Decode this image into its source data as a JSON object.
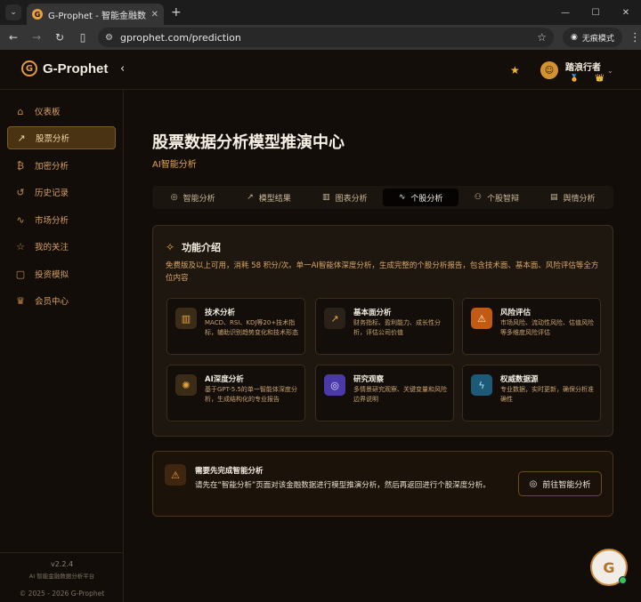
{
  "browser": {
    "tab_title": "G-Prophet - 智能金融数据分析",
    "url": "gprophet.com/prediction",
    "incognito_label": "无痕模式"
  },
  "header": {
    "brand": "G-Prophet",
    "user_name": "踏浪行者",
    "user_badges": "🏅 👑"
  },
  "sidebar": {
    "items": [
      {
        "label": "仪表板",
        "icon": "⌂"
      },
      {
        "label": "股票分析",
        "icon": "↗"
      },
      {
        "label": "加密分析",
        "icon": "₿"
      },
      {
        "label": "历史记录",
        "icon": "↺"
      },
      {
        "label": "市场分析",
        "icon": "∿"
      },
      {
        "label": "我的关注",
        "icon": "☆"
      },
      {
        "label": "投资模拟",
        "icon": "▢"
      },
      {
        "label": "会员中心",
        "icon": "♛"
      }
    ],
    "active_index": 1,
    "version": "v2.2.4",
    "version_sub": "AI 智能金融数据分析平台",
    "copyright": "© 2025 - 2026 G-Prophet"
  },
  "main": {
    "title": "股票数据分析模型推演中心",
    "subtitle": "AI智能分析",
    "tabs": [
      {
        "label": "智能分析",
        "icon": "◎"
      },
      {
        "label": "模型结果",
        "icon": "↗"
      },
      {
        "label": "图表分析",
        "icon": "▥"
      },
      {
        "label": "个股分析",
        "icon": "∿"
      },
      {
        "label": "个股智辩",
        "icon": "⚇"
      },
      {
        "label": "舆情分析",
        "icon": "▤"
      }
    ],
    "active_tab": 3
  },
  "features": {
    "title": "功能介绍",
    "desc": "免费版及以上可用，消耗 58 积分/次。单一AI智能体深度分析，生成完整的个股分析报告，包含技术面、基本面、风险评估等全方位内容",
    "items": [
      {
        "title": "技术分析",
        "desc": "MACD、RSI、KDJ等20+技术指标，辅助识别趋势变化和技术形态",
        "icon": "▥",
        "color": "#3a2c16",
        "icon_color": "#e6a43e"
      },
      {
        "title": "基本面分析",
        "desc": "财务指标、盈利能力、成长性分析，评估公司价值",
        "icon": "↗",
        "color": "#2a2218",
        "icon_color": "#e6a43e"
      },
      {
        "title": "风险评估",
        "desc": "市场风险、流动性风险、估值风险等多维度风险评估",
        "icon": "⚠",
        "color": "#c25a12",
        "icon_color": "#fff1dc"
      },
      {
        "title": "AI深度分析",
        "desc": "基于GPT-5.5的单一智能体深度分析，生成结构化的专业报告",
        "icon": "✺",
        "color": "#3a2c16",
        "icon_color": "#e6a43e"
      },
      {
        "title": "研究观察",
        "desc": "多情景研究观察、关键变量和风险边界说明",
        "icon": "◎",
        "color": "#4a3aa8",
        "icon_color": "#e4dcff"
      },
      {
        "title": "权威数据源",
        "desc": "专业数据，实时更新，确保分析准确性",
        "icon": "ϟ",
        "color": "#1d5a78",
        "icon_color": "#a6e6ff"
      }
    ]
  },
  "notice": {
    "title": "需要先完成智能分析",
    "text": "请先在“智能分析”页面对该金融数据进行模型推演分析，然后再返回进行个股深度分析。",
    "button": "前往智能分析"
  },
  "assistant": {
    "label": "G"
  }
}
